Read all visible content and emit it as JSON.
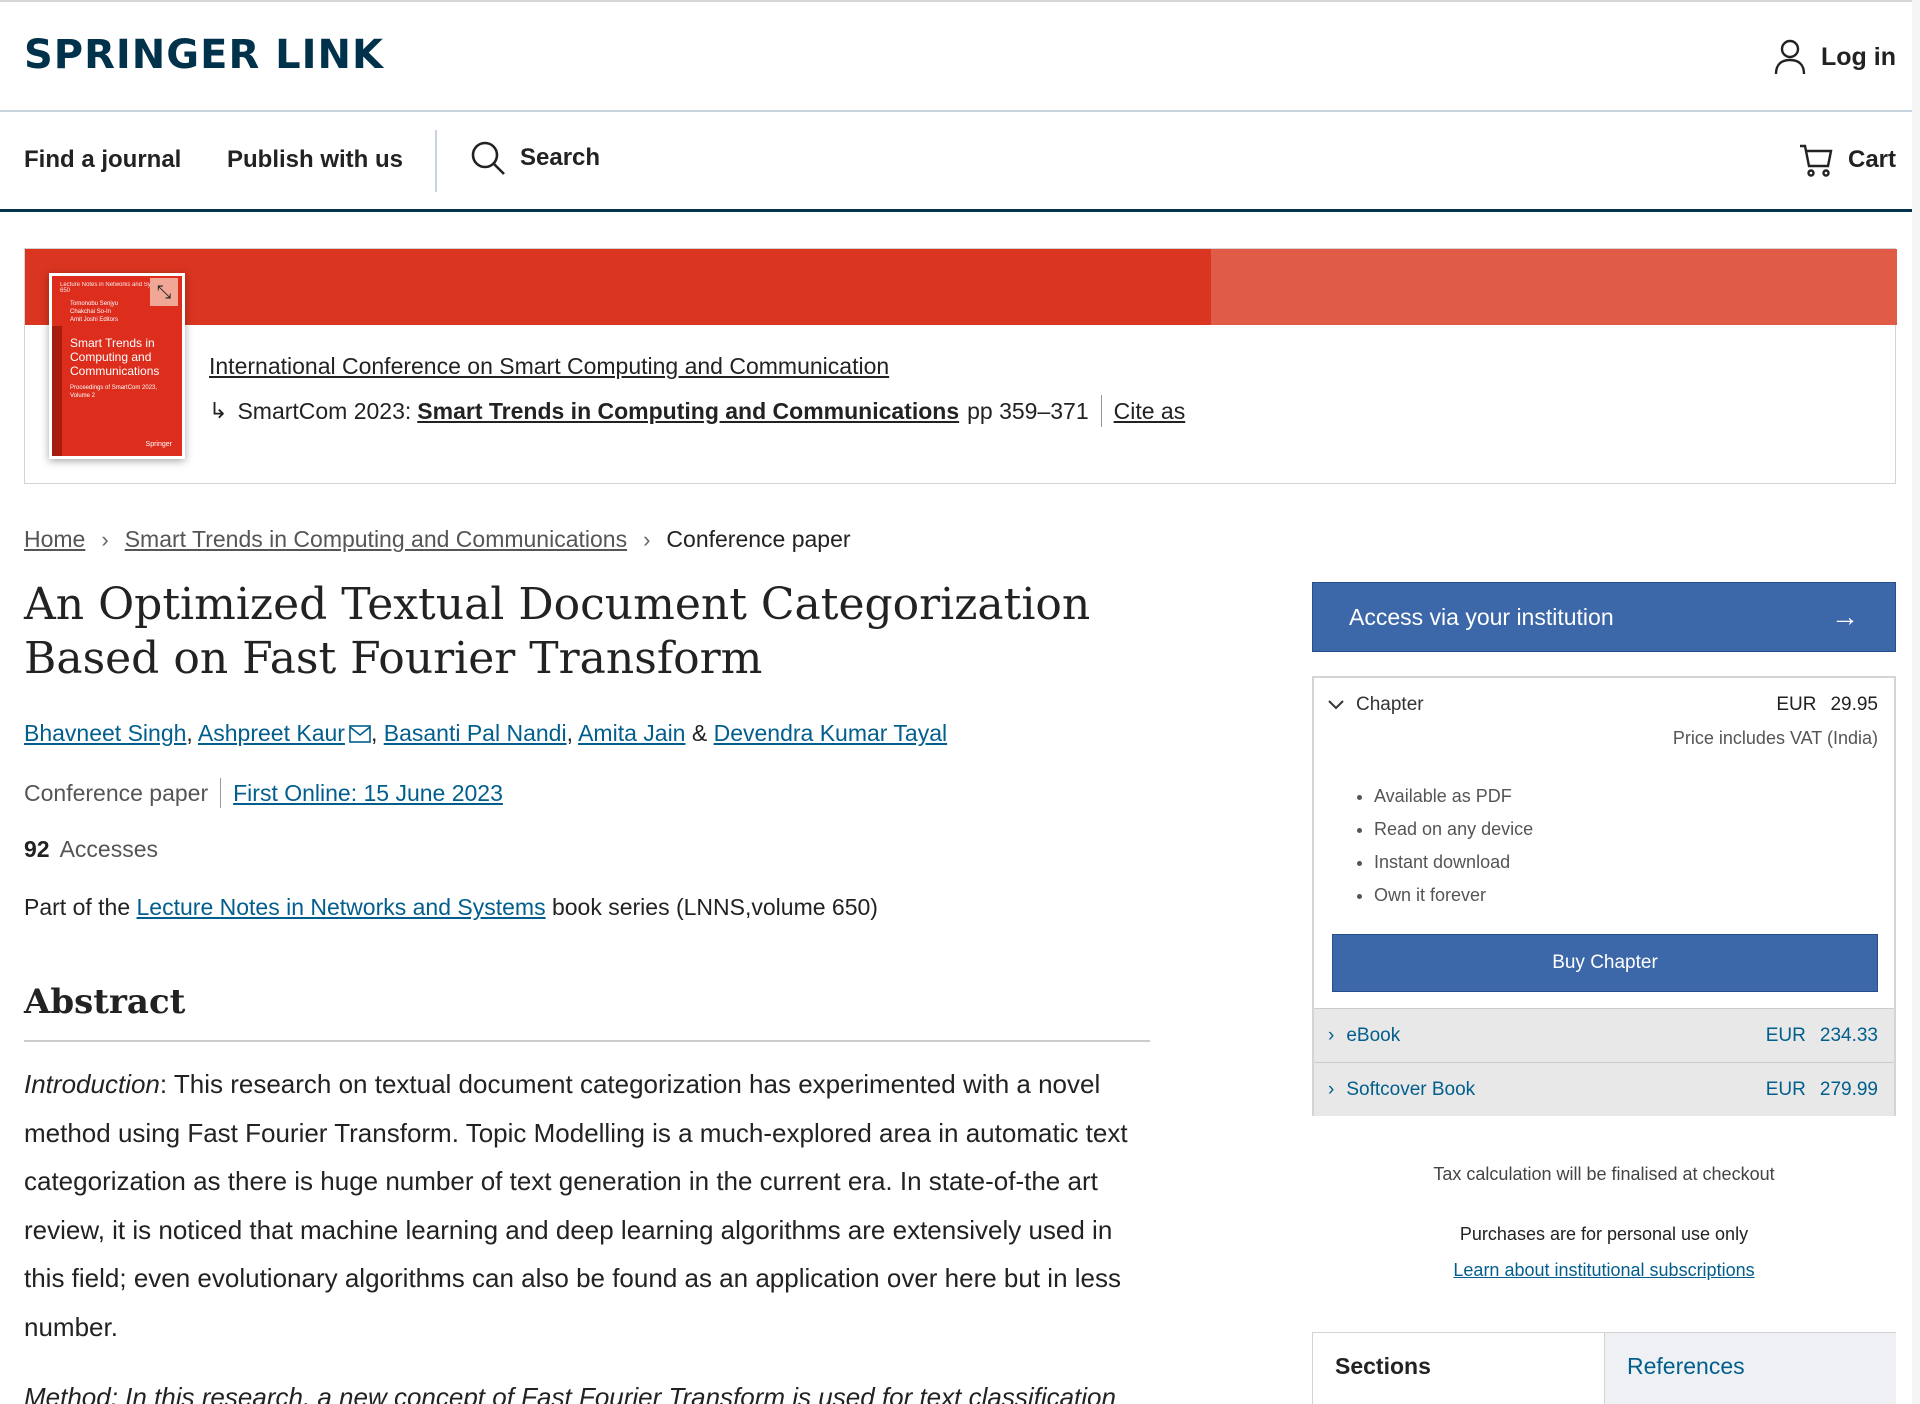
{
  "header": {
    "logo": "SPRINGER LINK",
    "login_label": "Log in"
  },
  "nav": {
    "find_journal": "Find a journal",
    "publish": "Publish with us",
    "search": "Search",
    "cart": "Cart"
  },
  "banner": {
    "conference_name": "International Conference on Smart Computing and Communication",
    "event": "SmartCom 2023:",
    "book_title": "Smart Trends in Computing and Communications",
    "pages": "pp 359–371",
    "cite_label": "Cite as",
    "cover": {
      "series": "Lecture Notes in Networks and Systems 650",
      "editors": [
        "Tomonobu Senjyu",
        "Chakchai So-In",
        "Amit Joshi  Editors"
      ],
      "title": "Smart Trends in Computing and Communications",
      "subtitle": "Proceedings of SmartCom 2023, Volume 2",
      "publisher": "Springer"
    }
  },
  "breadcrumb": {
    "home": "Home",
    "book": "Smart Trends in Computing and Communications",
    "current": "Conference paper"
  },
  "article": {
    "title": "An Optimized Textual Document Categorization Based on Fast Fourier Transform",
    "authors": [
      "Bhavneet Singh",
      "Ashpreet Kaur",
      "Basanti Pal Nandi",
      "Amita Jain",
      "Devendra Kumar Tayal"
    ],
    "type": "Conference paper",
    "first_online": "First Online: 15 June 2023",
    "accesses_count": "92",
    "accesses_label": "Accesses",
    "series_prefix": "Part of the",
    "series_link": "Lecture Notes in Networks and Systems",
    "series_suffix": "book series (LNNS,volume 650)"
  },
  "abstract": {
    "heading": "Abstract",
    "intro_label": "Introduction",
    "intro_text": ": This research on textual document categorization has experimented with a novel method using Fast Fourier Transform. Topic Modelling is a much-explored area in automatic text categorization as there is huge number of text generation in the current era. In state-of-the art review, it is noticed that machine learning and deep learning algorithms are extensively used in this field; even evolutionary algorithms can also be found as an application over here but in less number.",
    "next_partial": "Method: In this research, a new concept of Fast Fourier Transform is used for text classification"
  },
  "sidebar": {
    "access_label": "Access via your institution",
    "chapter_label": "Chapter",
    "currency": "EUR",
    "chapter_price": "29.95",
    "vat_note": "Price includes VAT (India)",
    "benefits": [
      "Available as PDF",
      "Read on any device",
      "Instant download",
      "Own it forever"
    ],
    "buy_label": "Buy Chapter",
    "formats": [
      {
        "label": "eBook",
        "currency": "EUR",
        "price": "234.33"
      },
      {
        "label": "Softcover Book",
        "currency": "EUR",
        "price": "279.99"
      }
    ],
    "tax_note": "Tax calculation will be finalised at checkout",
    "personal_note": "Purchases are for personal use only",
    "inst_link": "Learn about institutional subscriptions",
    "tabs": [
      "Sections",
      "References"
    ]
  },
  "colors": {
    "brand": "#01324b",
    "link": "#025e8d",
    "button": "#3c67a8",
    "banner_red": "#da3520"
  }
}
